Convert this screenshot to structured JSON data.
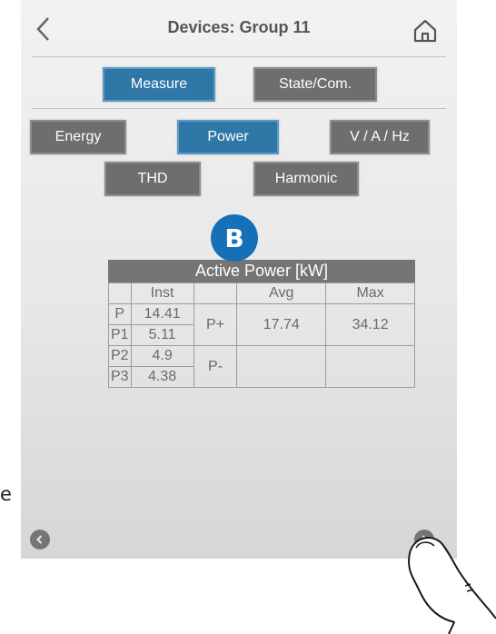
{
  "header": {
    "title": "Devices: Group 11"
  },
  "tabs": {
    "measure": "Measure",
    "state_com": "State/Com."
  },
  "categories": {
    "energy": "Energy",
    "power": "Power",
    "vah": "V / A / Hz",
    "thd": "THD",
    "harmonic": "Harmonic"
  },
  "badge": "B",
  "table": {
    "title": "Active Power [kW]",
    "headers": {
      "inst": "Inst",
      "avg": "Avg",
      "max": "Max"
    },
    "rows": [
      {
        "label": "P",
        "inst": "14.41"
      },
      {
        "label": "P1",
        "inst": "5.11"
      },
      {
        "label": "P2",
        "inst": "4.9"
      },
      {
        "label": "P3",
        "inst": "4.38"
      }
    ],
    "pplus": {
      "label": "P+",
      "avg": "17.74",
      "max": "34.12"
    },
    "pminus": {
      "label": "P-",
      "avg": "",
      "max": ""
    }
  },
  "side_text": "e",
  "colors": {
    "active": "#2f77a6",
    "inactive": "#6e6e6e",
    "badge": "#1670b7"
  },
  "icons": [
    "back-arrow-icon",
    "home-icon",
    "nav-left-icon",
    "nav-right-icon",
    "pointing-hand-icon"
  ]
}
